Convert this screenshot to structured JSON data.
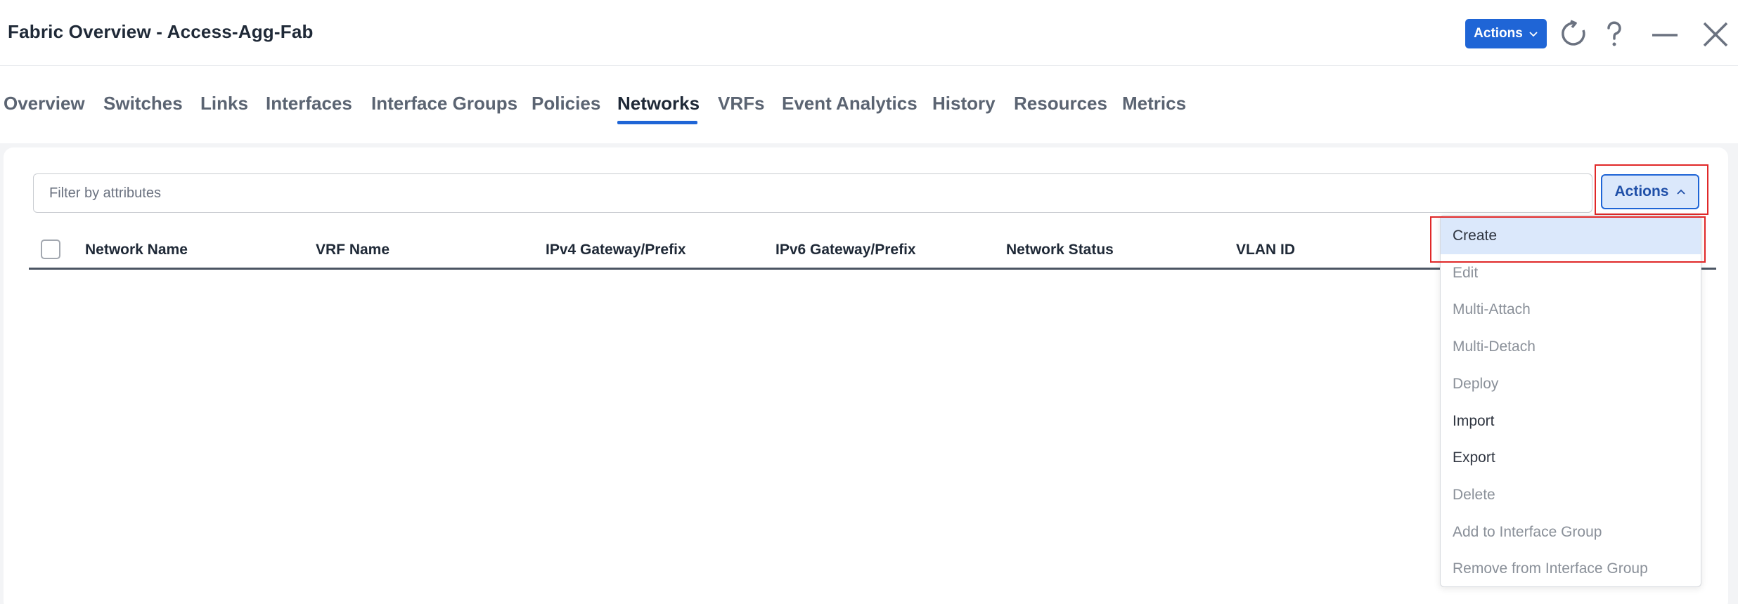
{
  "header": {
    "title": "Fabric Overview - Access-Agg-Fab",
    "actions_label": "Actions"
  },
  "tabs": [
    {
      "label": "Overview"
    },
    {
      "label": "Switches"
    },
    {
      "label": "Links"
    },
    {
      "label": "Interfaces"
    },
    {
      "label": "Interface Groups"
    },
    {
      "label": "Policies"
    },
    {
      "label": "Networks",
      "active": true
    },
    {
      "label": "VRFs"
    },
    {
      "label": "Event Analytics"
    },
    {
      "label": "History"
    },
    {
      "label": "Resources"
    },
    {
      "label": "Metrics"
    }
  ],
  "filter": {
    "placeholder": "Filter by attributes",
    "value": ""
  },
  "panel_actions": {
    "label": "Actions"
  },
  "table": {
    "columns": [
      "Network Name",
      "VRF Name",
      "IPv4 Gateway/Prefix",
      "IPv6 Gateway/Prefix",
      "Network Status",
      "VLAN ID"
    ]
  },
  "dropdown": {
    "items": [
      {
        "label": "Create",
        "enabled": true,
        "highlighted": true
      },
      {
        "label": "Edit",
        "enabled": false
      },
      {
        "label": "Multi-Attach",
        "enabled": false
      },
      {
        "label": "Multi-Detach",
        "enabled": false
      },
      {
        "label": "Deploy",
        "enabled": false
      },
      {
        "label": "Import",
        "enabled": true
      },
      {
        "label": "Export",
        "enabled": true
      },
      {
        "label": "Delete",
        "enabled": false
      },
      {
        "label": "Add to Interface Group",
        "enabled": false
      },
      {
        "label": "Remove from Interface Group",
        "enabled": false
      }
    ]
  },
  "colors": {
    "accent": "#1f65d6",
    "highlight": "#dbe8fb",
    "annotation": "#e02828"
  },
  "icons": [
    "chevron-down-icon",
    "refresh-icon",
    "help-icon",
    "minimize-icon",
    "close-icon",
    "chevron-up-icon"
  ]
}
